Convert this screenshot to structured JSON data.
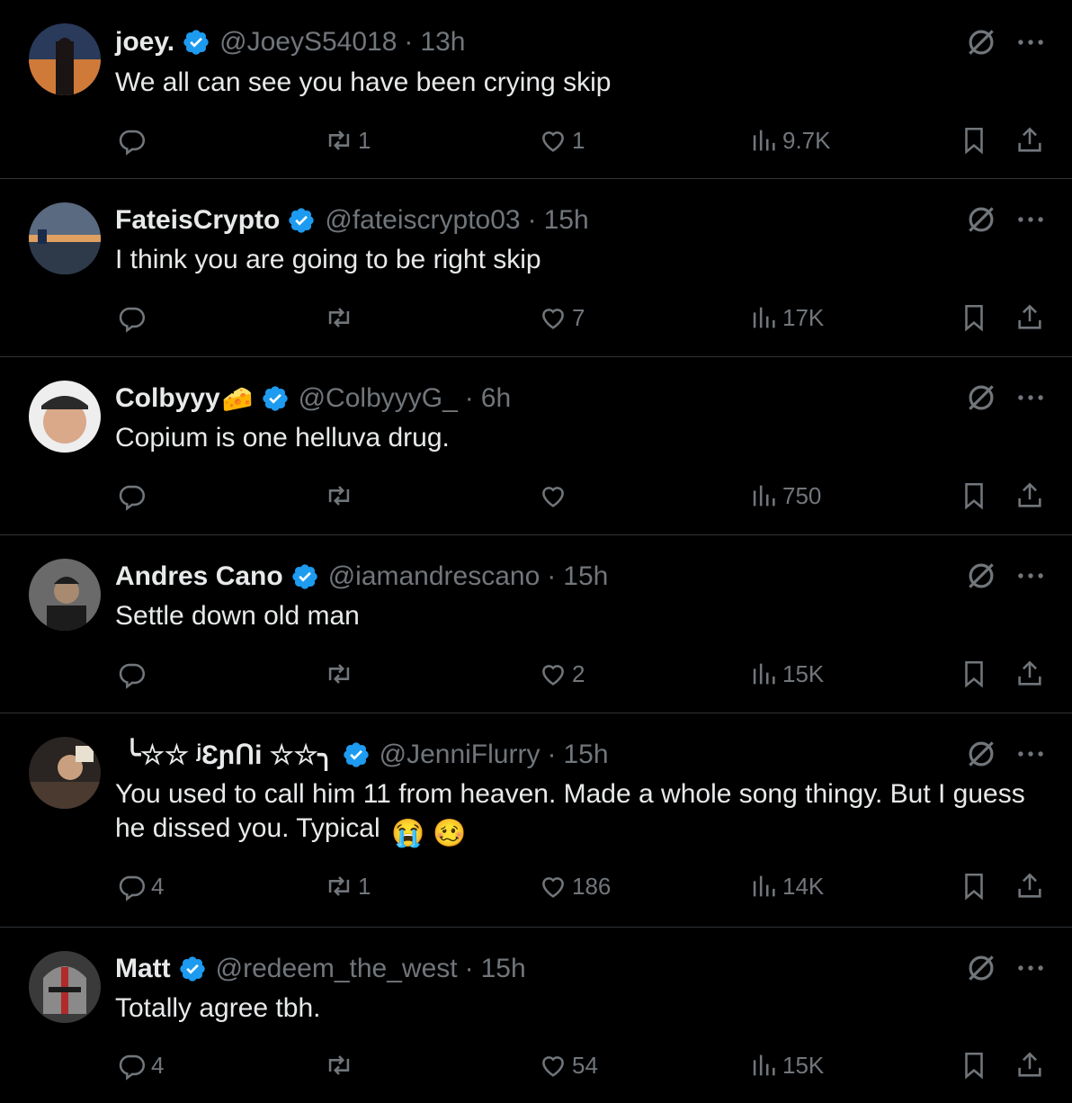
{
  "tweets": [
    {
      "name": "joey.",
      "name_extra": "",
      "handle": "@JoeyS54018",
      "time": "13h",
      "text": "We all can see you have been crying skip",
      "replies": "",
      "retweets": "1",
      "likes": "1",
      "views": "9.7K",
      "avatar_colors": [
        "#3b2a2a",
        "#d07a3a",
        "#2a3a5a"
      ]
    },
    {
      "name": "FateisCrypto",
      "name_extra": "",
      "handle": "@fateiscrypto03",
      "time": "15h",
      "text": "I think you are going to be right skip",
      "replies": "",
      "retweets": "",
      "likes": "7",
      "views": "17K",
      "avatar_colors": [
        "#5a6a80",
        "#e0a060",
        "#2e3a4a"
      ]
    },
    {
      "name": "Colbyyy",
      "name_extra": "🧀",
      "handle": "@ColbyyyG_",
      "time": "6h",
      "text": "Copium is one helluva drug.",
      "replies": "",
      "retweets": "",
      "likes": "",
      "views": "750",
      "avatar_colors": [
        "#2a2a2a",
        "#d9a98a",
        "#eeeeee"
      ]
    },
    {
      "name": "Andres Cano",
      "name_extra": "",
      "handle": "@iamandrescano",
      "time": "15h",
      "text": "Settle down old man",
      "replies": "",
      "retweets": "",
      "likes": "2",
      "views": "15K",
      "avatar_colors": [
        "#6a6a6a",
        "#a88a70",
        "#1c1c1c"
      ]
    },
    {
      "name": "╰☆☆ ʲƐɲՈі ☆☆╮",
      "name_extra": "",
      "handle": "@JenniFlurry",
      "time": "15h",
      "text": "You used to call him 11 from heaven. Made a whole song thingy. But I guess he dissed you. Typical",
      "text_emojis": [
        "😭",
        "🥴"
      ],
      "replies": "4",
      "retweets": "1",
      "likes": "186",
      "views": "14K",
      "avatar_colors": [
        "#4a3a30",
        "#c8a080",
        "#2a2522"
      ]
    },
    {
      "name": "Matt",
      "name_extra": "",
      "handle": "@redeem_the_west",
      "time": "15h",
      "text": "Totally agree tbh.",
      "replies": "4",
      "retweets": "",
      "likes": "54",
      "views": "15K",
      "avatar_colors": [
        "#3a3a3a",
        "#b02a2a",
        "#8a8a8a"
      ]
    }
  ],
  "colors": {
    "background": "#000000",
    "text": "#e7e9ea",
    "muted": "#71767b",
    "verified": "#1d9bf0",
    "divider": "#2f3336"
  },
  "icons": {
    "verified": "verified-badge-icon",
    "grok": "grok-icon",
    "more": "more-icon",
    "reply": "reply-icon",
    "retweet": "retweet-icon",
    "like": "heart-icon",
    "views": "views-icon",
    "bookmark": "bookmark-icon",
    "share": "share-icon"
  }
}
